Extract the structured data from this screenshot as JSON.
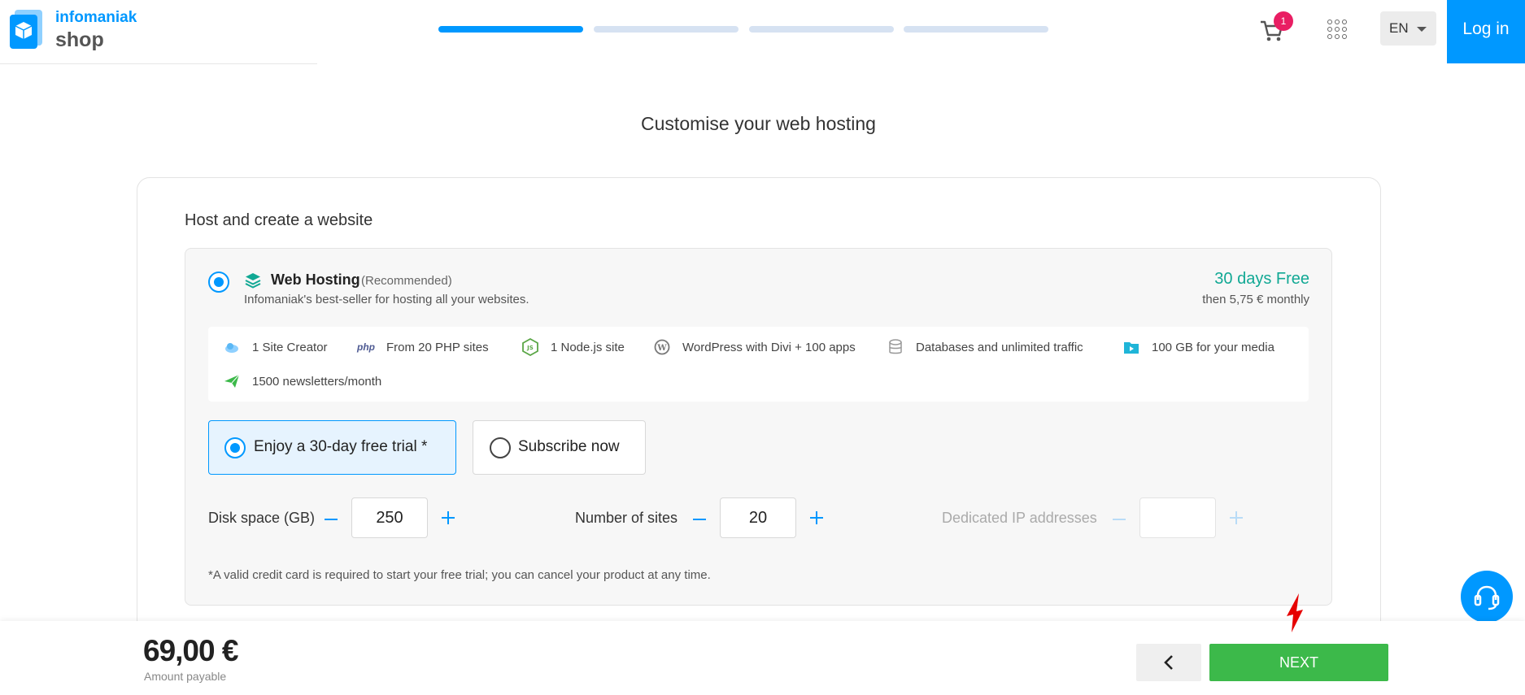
{
  "brand": {
    "name": "infomaniak",
    "sub": "shop"
  },
  "header": {
    "progress": [
      true,
      false,
      false,
      false
    ],
    "cart_count": "1",
    "language": "EN",
    "login_label": "Log in"
  },
  "page": {
    "title": "Customise your web hosting"
  },
  "section": {
    "title": "Host and create a website"
  },
  "product": {
    "name": "Web Hosting",
    "badge": "(Recommended)",
    "description": "Infomaniak's best-seller for hosting all your websites.",
    "price_primary": "30 days Free",
    "price_secondary": "then 5,75 € monthly",
    "features": [
      {
        "icon": "cloud-icon",
        "label": "1 Site Creator"
      },
      {
        "icon": "php-icon",
        "label": "From 20 PHP sites"
      },
      {
        "icon": "nodejs-icon",
        "label": "1 Node.js site"
      },
      {
        "icon": "wordpress-icon",
        "label": "WordPress with Divi + 100 apps"
      },
      {
        "icon": "database-icon",
        "label": "Databases and unlimited traffic"
      },
      {
        "icon": "media-folder-icon",
        "label": "100 GB for your media"
      },
      {
        "icon": "paper-plane-icon",
        "label": "1500 newsletters/month"
      }
    ]
  },
  "options": {
    "trial_label": "Enjoy a 30-day free trial *",
    "subscribe_label": "Subscribe now",
    "selected": "trial"
  },
  "fields": {
    "disk": {
      "label": "Disk space (GB)",
      "value": "250"
    },
    "sites": {
      "label": "Number of sites",
      "value": "20"
    },
    "ips": {
      "label": "Dedicated IP addresses",
      "value": ""
    }
  },
  "footnote": "*A valid credit card is required to start your free trial; you can cancel your product at any time.",
  "footer": {
    "amount": "69,00 €",
    "amount_label": "Amount payable",
    "next_label": "NEXT"
  },
  "colors": {
    "accent": "#0098ff",
    "green": "#3cb94a",
    "teal": "#11a894",
    "badge": "#e91e63"
  }
}
